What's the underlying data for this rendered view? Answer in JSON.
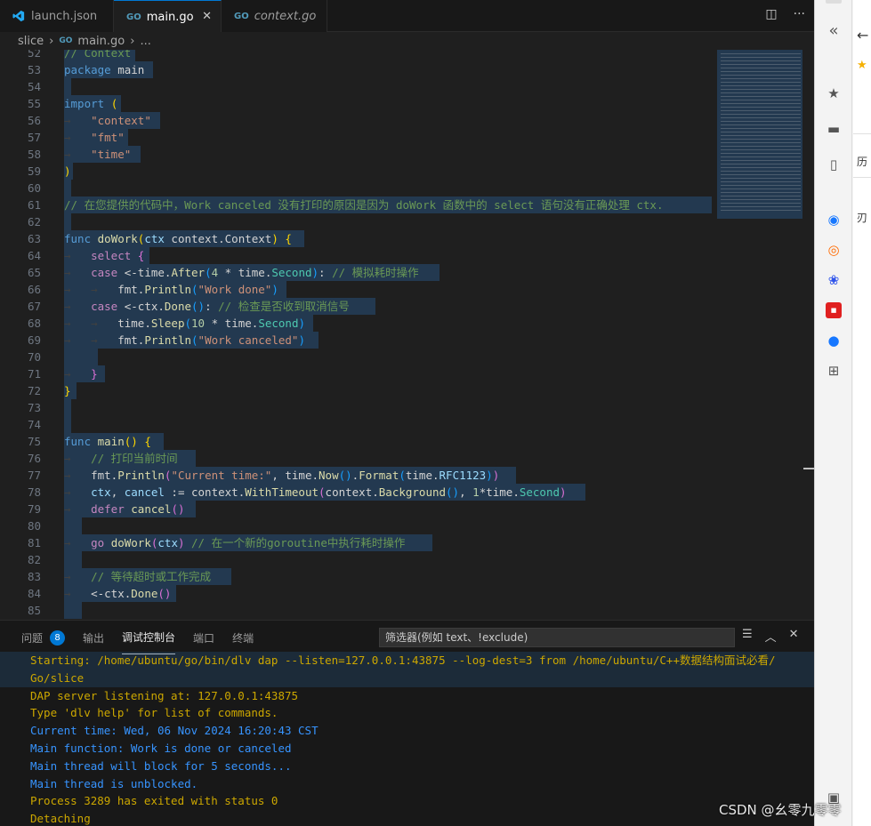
{
  "tabs": [
    {
      "label": "launch.json",
      "icon": "vscode-icon"
    },
    {
      "label": "main.go",
      "icon": "go-icon",
      "active": true
    },
    {
      "label": "context.go",
      "icon": "go-icon",
      "italic": true
    }
  ],
  "tab_icon_text": "GO",
  "breadcrumb": {
    "folder": "slice",
    "file": "main.go",
    "more": "..."
  },
  "panel": {
    "tabs": {
      "problems": "问题",
      "problems_count": "8",
      "output": "输出",
      "debug_console": "调试控制台",
      "ports": "端口",
      "terminal": "终端"
    },
    "filter_placeholder": "筛选器(例如 text、!exclude)"
  },
  "console_lines": [
    {
      "text": "Starting: /home/ubuntu/go/bin/dlv dap --listen=127.0.0.1:43875 --log-dest=3 from /home/ubuntu/C++数据结构面试必看/",
      "color": "orange"
    },
    {
      "text": "Go/slice",
      "color": "orange"
    },
    {
      "text": "DAP server listening at: 127.0.0.1:43875",
      "color": "orange"
    },
    {
      "text": "Type 'dlv help' for list of commands.",
      "color": "orange"
    },
    {
      "text": "Current time: Wed, 06 Nov 2024 16:20:43 CST",
      "color": "blue"
    },
    {
      "text": "Main function: Work is done or canceled",
      "color": "blue"
    },
    {
      "text": "Main thread will block for 5 seconds...",
      "color": "blue"
    },
    {
      "text": "Main thread is unblocked.",
      "color": "blue"
    },
    {
      "text": "Process 3289 has exited with status 0",
      "color": "orange"
    },
    {
      "text": "Detaching",
      "color": "orange"
    }
  ],
  "watermark": "CSDN @幺零九零零",
  "browser": {
    "side_text_1": "历",
    "side_text_2": "刃"
  },
  "colors": {
    "accent": "#0078d4",
    "orange": "#cca700",
    "blue": "#3794ff",
    "selection": "#264f78"
  }
}
